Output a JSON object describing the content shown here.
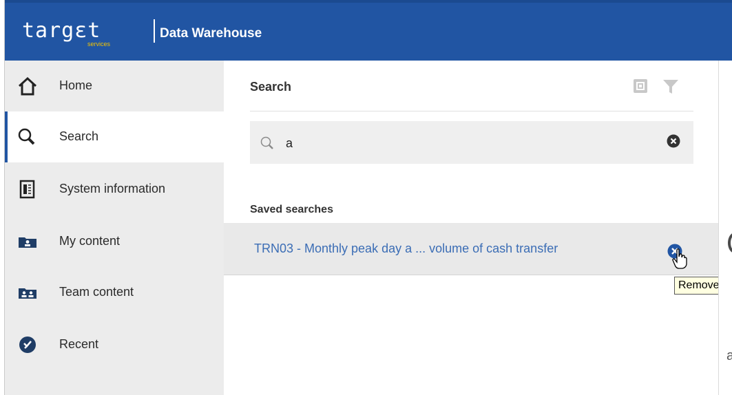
{
  "header": {
    "logo_text": "targɛt",
    "logo_sub": "services",
    "app_title": "Data Warehouse"
  },
  "sidebar": {
    "items": [
      {
        "label": "Home",
        "icon": "home-icon"
      },
      {
        "label": "Search",
        "icon": "search-icon",
        "active": true
      },
      {
        "label": "System information",
        "icon": "system-info-icon"
      },
      {
        "label": "My content",
        "icon": "my-content-folder-icon"
      },
      {
        "label": "Team content",
        "icon": "team-content-folder-icon"
      },
      {
        "label": "Recent",
        "icon": "recent-icon"
      }
    ]
  },
  "main": {
    "title": "Search",
    "search": {
      "value": "a"
    },
    "saved_heading": "Saved searches",
    "saved_items": [
      {
        "label": "TRN03 - Monthly peak day a ... volume of cash transfer"
      }
    ],
    "tooltip": "Remove"
  },
  "right_partial": {
    "char": "a"
  },
  "colors": {
    "header_bg": "#2155a3",
    "sidebar_bg": "#ececec",
    "link": "#3b6db5",
    "accent_yellow": "#f5c400"
  }
}
